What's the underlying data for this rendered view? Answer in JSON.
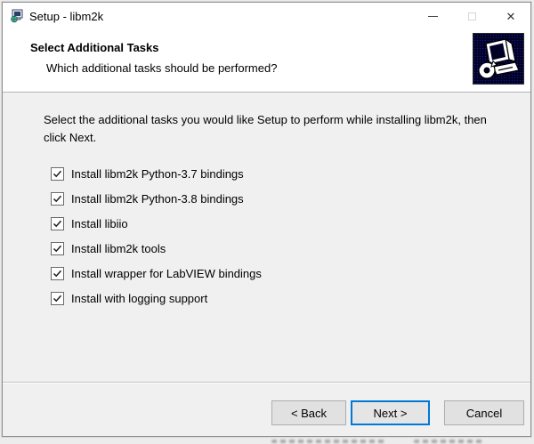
{
  "window": {
    "title": "Setup - libm2k",
    "controls": {
      "close_glyph": "✕"
    }
  },
  "header": {
    "title": "Select Additional Tasks",
    "subtitle": "Which additional tasks should be performed?"
  },
  "body": {
    "instruction": "Select the additional tasks you would like Setup to perform while installing libm2k, then click Next.",
    "tasks": [
      {
        "label": "Install libm2k Python-3.7 bindings",
        "checked": true
      },
      {
        "label": "Install libm2k Python-3.8 bindings",
        "checked": true
      },
      {
        "label": "Install libiio",
        "checked": true
      },
      {
        "label": "Install libm2k tools",
        "checked": true
      },
      {
        "label": "Install wrapper for LabVIEW bindings",
        "checked": true
      },
      {
        "label": "Install with logging support",
        "checked": true
      }
    ]
  },
  "footer": {
    "back_label": "< Back",
    "next_label": "Next >",
    "cancel_label": "Cancel"
  },
  "colors": {
    "accent": "#0078d7",
    "titlebar_bg": "#ffffff",
    "body_bg": "#f0f0f0",
    "button_bg": "#e1e1e1",
    "button_border": "#adadad",
    "icon_bg": "#000026"
  }
}
